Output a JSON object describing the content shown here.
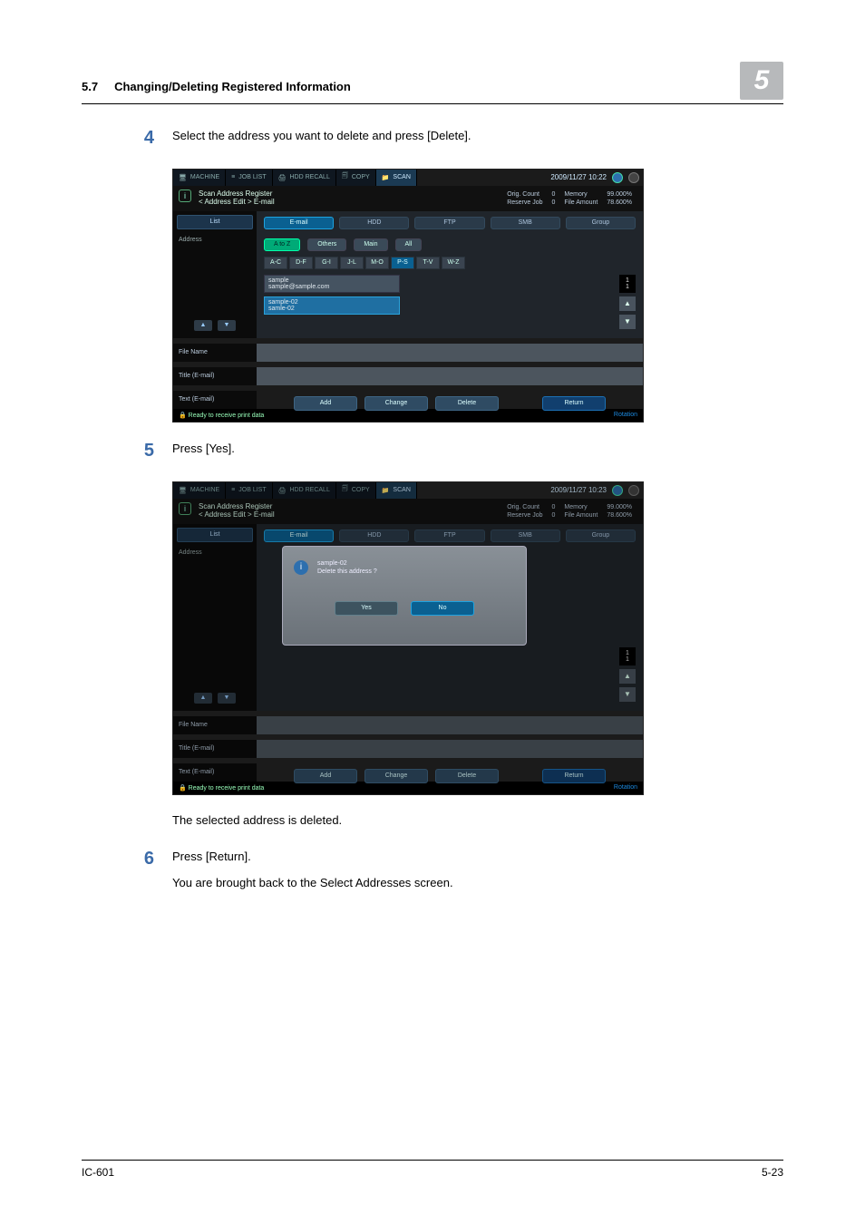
{
  "header": {
    "section": "5.7",
    "title": "Changing/Deleting Registered Information",
    "chapter": "5"
  },
  "steps": {
    "s4": {
      "num": "4",
      "text": "Select the address you want to delete and press [Delete]."
    },
    "s5": {
      "num": "5",
      "text": "Press [Yes]."
    },
    "s6": {
      "num": "6",
      "text1": "Press [Return].",
      "text2": "You are brought back to the Select Addresses screen."
    }
  },
  "post5": "The selected address is deleted.",
  "footer": {
    "left": "IC-601",
    "right": "5-23"
  },
  "ui": {
    "nav": {
      "machine": "MACHINE",
      "joblist": "JOB LIST",
      "hddrecall": "HDD RECALL",
      "copy": "COPY",
      "scan": "SCAN"
    },
    "datetime1": "2009/11/27 10:22",
    "datetime2": "2009/11/27 10:23",
    "subtitle_l1": "Scan Address Register",
    "subtitle_l2": "< Address Edit > E-mail",
    "counters": {
      "orig": "Orig. Count",
      "orig_v": "0",
      "reserve": "Reserve Job",
      "reserve_v": "0",
      "mem": "Memory",
      "mem_v": "99.000%",
      "file": "File Amount",
      "file_v": "78.600%"
    },
    "side": {
      "list": "List",
      "address": "Address"
    },
    "tabs": {
      "email": "E-mail",
      "hdd": "HDD",
      "ftp": "FTP",
      "smb": "SMB",
      "group": "Group"
    },
    "filters": {
      "atoz": "A to Z",
      "others": "Others",
      "main": "Main",
      "all": "All"
    },
    "alpha": {
      "a": "A-C",
      "b": "D-F",
      "c": "G-I",
      "d": "J-L",
      "e": "M-O",
      "f": "P-S",
      "g": "T-V",
      "h": "W-Z"
    },
    "entries": {
      "e1_name": "sample",
      "e1_addr": "sample@sample.com",
      "e2_name": "sample-02",
      "e2_addr": "samle-02"
    },
    "pager": "1\n1",
    "formlabels": {
      "file": "File Name",
      "title": "Title (E-mail)",
      "text": "Text (E-mail)"
    },
    "buttons": {
      "add": "Add",
      "change": "Change",
      "delete": "Delete",
      "return": "Return"
    },
    "status": "Ready to receive print data",
    "rotation": "Rotation",
    "dialog": {
      "name": "sample-02",
      "msg": "Delete this address ?",
      "yes": "Yes",
      "no": "No"
    }
  }
}
